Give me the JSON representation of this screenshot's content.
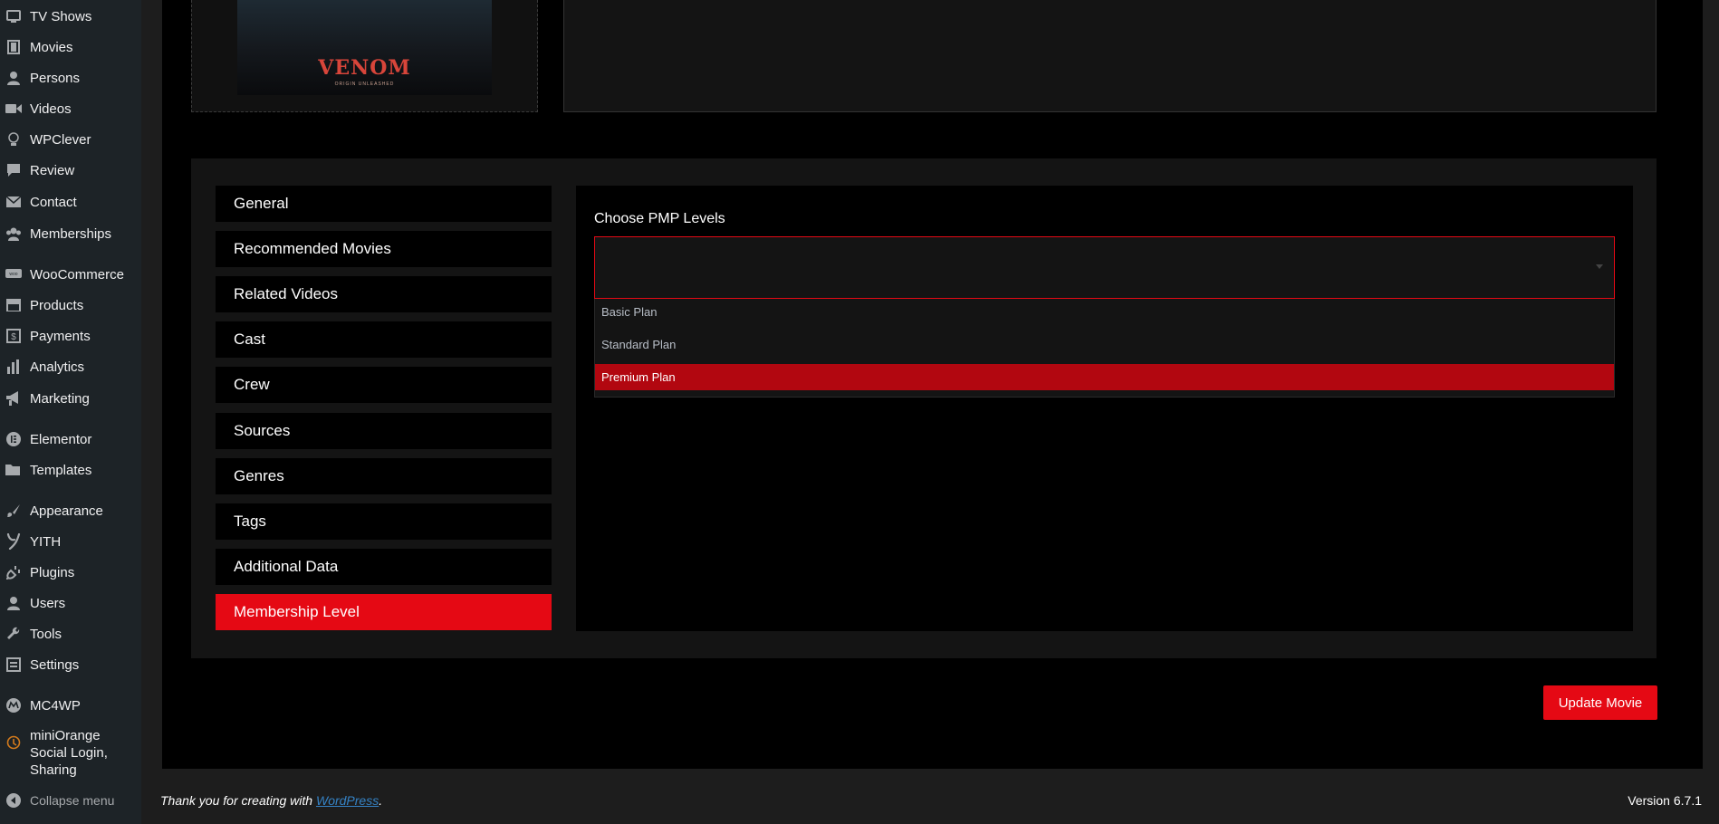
{
  "sidebar": {
    "items": [
      {
        "label": "TV Shows",
        "icon": "tv-icon"
      },
      {
        "label": "Movies",
        "icon": "film-icon"
      },
      {
        "label": "Persons",
        "icon": "person-icon"
      },
      {
        "label": "Videos",
        "icon": "video-camera-icon"
      },
      {
        "label": "WPClever",
        "icon": "lightbulb-icon"
      },
      {
        "label": "Review",
        "icon": "comment-icon"
      },
      {
        "label": "Contact",
        "icon": "envelope-icon"
      },
      {
        "label": "Memberships",
        "icon": "group-icon"
      },
      {
        "label": "WooCommerce",
        "icon": "woocommerce-icon"
      },
      {
        "label": "Products",
        "icon": "archive-icon"
      },
      {
        "label": "Payments",
        "icon": "dollar-icon"
      },
      {
        "label": "Analytics",
        "icon": "bar-chart-icon"
      },
      {
        "label": "Marketing",
        "icon": "megaphone-icon"
      },
      {
        "label": "Elementor",
        "icon": "elementor-icon"
      },
      {
        "label": "Templates",
        "icon": "folder-icon"
      },
      {
        "label": "Appearance",
        "icon": "paintbrush-icon"
      },
      {
        "label": "YITH",
        "icon": "yith-icon"
      },
      {
        "label": "Plugins",
        "icon": "plug-icon"
      },
      {
        "label": "Users",
        "icon": "user-icon"
      },
      {
        "label": "Tools",
        "icon": "wrench-icon"
      },
      {
        "label": "Settings",
        "icon": "settings-icon"
      },
      {
        "label": "MC4WP",
        "icon": "mc4wp-icon"
      },
      {
        "label": "miniOrange Social Login, Sharing",
        "icon": "miniorange-icon"
      }
    ],
    "collapse_label": "Collapse menu"
  },
  "poster": {
    "title": "VENOM",
    "subtitle": "ORIGIN UNLEASHED"
  },
  "tabs": [
    {
      "label": "General"
    },
    {
      "label": "Recommended Movies"
    },
    {
      "label": "Related Videos"
    },
    {
      "label": "Cast"
    },
    {
      "label": "Crew"
    },
    {
      "label": "Sources"
    },
    {
      "label": "Genres"
    },
    {
      "label": "Tags"
    },
    {
      "label": "Additional Data"
    },
    {
      "label": "Membership Level"
    }
  ],
  "active_tab": "Membership Level",
  "pmp": {
    "label": "Choose PMP Levels",
    "selected_value": "",
    "options": [
      "Basic Plan",
      "Standard Plan",
      "Premium Plan"
    ],
    "highlighted_option": "Premium Plan"
  },
  "update_button": "Update Movie",
  "footer": {
    "thanks_prefix": "Thank you for creating with ",
    "link": "WordPress",
    "suffix": ".",
    "version": "Version 6.7.1"
  },
  "colors": {
    "accent": "#e50914",
    "highlight": "#b20710",
    "link": "#3582c4",
    "sidebar_bg": "#1d2327"
  }
}
